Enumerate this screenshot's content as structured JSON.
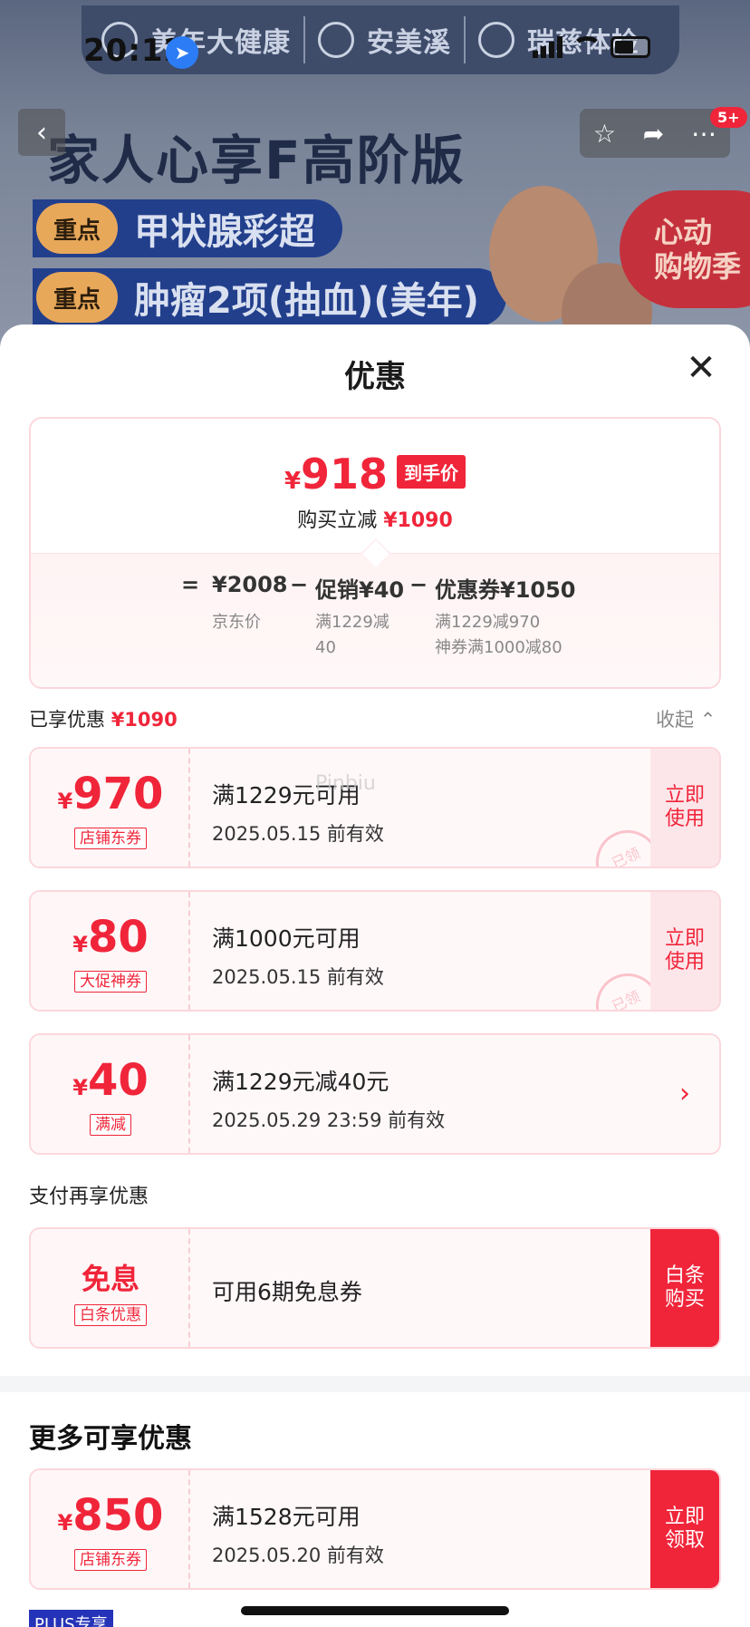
{
  "status_bar": {
    "time": "20:12"
  },
  "banner": {
    "logos": [
      "美年大健康",
      "安美溪",
      "瑞慈体检"
    ],
    "title": "家人心享F高阶版",
    "key_points": [
      {
        "tag": "重点",
        "text": "甲状腺彩超"
      },
      {
        "tag": "重点",
        "text": "肿瘤2项(抽血)(美年)"
      }
    ],
    "promo": [
      "心动",
      "购物季"
    ],
    "badge": "5+"
  },
  "sheet": {
    "title": "优惠",
    "summary": {
      "final_currency": "¥",
      "final_price": "918",
      "final_tag": "到手价",
      "reduce_label": "购买立减",
      "reduce_amount": "¥1090",
      "equals": "=",
      "jd_price": "¥2008",
      "jd_label": "京东价",
      "promo_label": "促销¥40",
      "promo_sub": [
        "满1229减",
        "40"
      ],
      "coupon_label": "优惠券¥1050",
      "coupon_sub": [
        "满1229减970",
        "神券满1000减80"
      ]
    },
    "enjoyed": {
      "label": "已享优惠",
      "amount": "¥1090",
      "collapse": "收起"
    },
    "coupons": [
      {
        "amount": "970",
        "type": "店铺东券",
        "condition": "满1229元可用",
        "expiry": "2025.05.15 前有效",
        "action": [
          "立即",
          "使用"
        ],
        "stamp": "已领"
      },
      {
        "amount": "80",
        "type": "大促神券",
        "condition": "满1000元可用",
        "expiry": "2025.05.15 前有效",
        "action": [
          "立即",
          "使用"
        ],
        "stamp": "已领"
      },
      {
        "amount": "40",
        "type": "满减",
        "condition": "满1229元减40元",
        "expiry": "2025.05.29 23:59 前有效",
        "action": [
          "›"
        ]
      }
    ],
    "pay": {
      "heading": "支付再享优惠",
      "amount": "免息",
      "type": "白条优惠",
      "condition": "可用6期免息券",
      "action": [
        "白条",
        "购买"
      ]
    },
    "more": {
      "heading": "更多可享优惠",
      "coupon": {
        "amount": "850",
        "type": "店铺东券",
        "condition": "满1528元可用",
        "expiry": "2025.05.20 前有效",
        "action": [
          "立即",
          "领取"
        ]
      },
      "plus_tag": "PLUS专享"
    },
    "watermark": "Pinbiu"
  }
}
